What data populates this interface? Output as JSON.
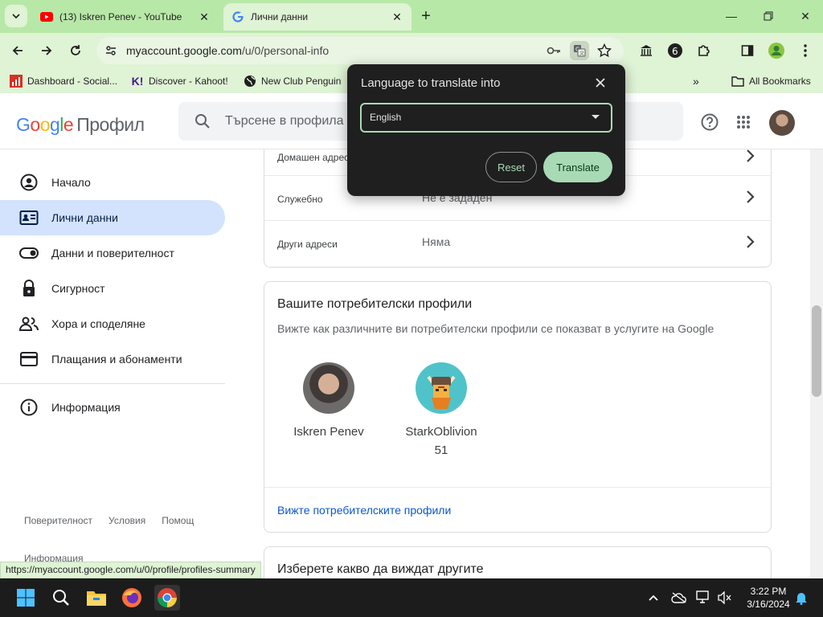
{
  "browser": {
    "tabs": [
      {
        "label": "(13) Iskren Penev - YouTube",
        "favicon": "youtube-icon",
        "active": false
      },
      {
        "label": "Лични данни",
        "favicon": "google-g-icon",
        "active": true
      }
    ],
    "new_tab_label": "+",
    "address": {
      "domain": "myaccount.google.com",
      "path": "/u/0/personal-info"
    },
    "bookmarks": [
      {
        "label": "Dashboard - Social...",
        "icon": "chart-icon"
      },
      {
        "label": "Discover - Kahoot!",
        "icon": "kahoot-icon"
      },
      {
        "label": "New Club Penguin",
        "icon": "globe-icon"
      }
    ],
    "all_bookmarks_label": "All Bookmarks",
    "status_url": "https://myaccount.google.com/u/0/profile/profiles-summary"
  },
  "header": {
    "logo_google": "Google",
    "logo_product": "Профил",
    "search_placeholder": "Търсене в профила"
  },
  "sidenav": {
    "items": [
      {
        "label": "Начало",
        "icon": "account-circle-icon",
        "active": false
      },
      {
        "label": "Лични данни",
        "icon": "id-card-icon",
        "active": true
      },
      {
        "label": "Данни и поверителност",
        "icon": "toggle-icon",
        "active": false
      },
      {
        "label": "Сигурност",
        "icon": "lock-icon",
        "active": false
      },
      {
        "label": "Хора и споделяне",
        "icon": "people-icon",
        "active": false
      },
      {
        "label": "Плащания и абонаменти",
        "icon": "credit-card-icon",
        "active": false
      }
    ],
    "info_label": "Информация",
    "footer": {
      "privacy": "Поверителност",
      "terms": "Условия",
      "help": "Помощ",
      "more": "Информация"
    }
  },
  "main": {
    "addresses": [
      {
        "label": "Домашен адрес",
        "value": ""
      },
      {
        "label": "Служебно",
        "value": "Не е зададен"
      },
      {
        "label": "Други адреси",
        "value": "Няма"
      }
    ],
    "profiles": {
      "title": "Вашите потребителски профили",
      "subtitle": "Вижте как различните ви потребителски профили се показват в услугите на Google",
      "people": [
        {
          "name": "Iskren Penev",
          "extra": ""
        },
        {
          "name": "StarkOblivion",
          "extra": "51"
        }
      ],
      "link": "Вижте потребителските профили"
    },
    "choose_title": "Изберете какво да виждат другите"
  },
  "translate_popup": {
    "title": "Language to translate into",
    "selected_language": "English",
    "reset_label": "Reset",
    "translate_label": "Translate"
  },
  "taskbar": {
    "time": "3:22 PM",
    "date": "3/16/2024"
  }
}
